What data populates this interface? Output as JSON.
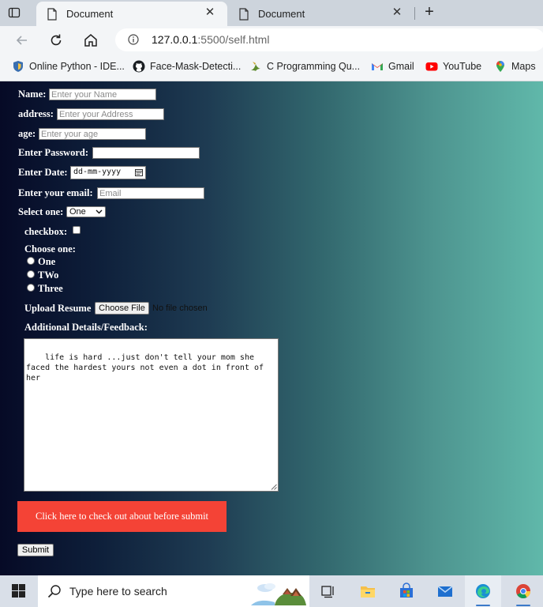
{
  "browser": {
    "tabs": [
      {
        "title": "Document",
        "active": true
      },
      {
        "title": "Document",
        "active": false
      }
    ],
    "url": {
      "host": "127.0.0.1",
      "rest": ":5500/self.html"
    },
    "bookmarks": [
      {
        "label": "Online Python - IDE...",
        "icon": "python-shield-icon"
      },
      {
        "label": "Face-Mask-Detecti...",
        "icon": "github-icon"
      },
      {
        "label": "C Programming Qu...",
        "icon": "bird-icon"
      },
      {
        "label": "Gmail",
        "icon": "gmail-icon"
      },
      {
        "label": "YouTube",
        "icon": "youtube-icon"
      },
      {
        "label": "Maps",
        "icon": "maps-pin-icon"
      }
    ]
  },
  "form": {
    "name_label": "Name:",
    "name_placeholder": "Enter your Name",
    "address_label": "address:",
    "address_placeholder": "Enter your Address",
    "age_label": "age:",
    "age_placeholder": "Enter your age",
    "password_label": "Enter Password:",
    "date_label": "Enter Date:",
    "date_value": "dd-mm-yyyy",
    "email_label": "Enter your email:",
    "email_placeholder": "Email",
    "select_label": "Select one:",
    "select_value": "One",
    "checkbox_label": "checkbox:",
    "choose_label": "Choose one:",
    "radios": [
      "One",
      "TWo",
      "Three"
    ],
    "upload_label": "Upload Resume",
    "file_button": "Choose File",
    "file_status": "No file chosen",
    "feedback_label": "Additional Details/Feedback:",
    "feedback_text": "life is hard ...just don't tell your mom she faced the hardest yours not even a dot in front of her",
    "about_button": "Click here to check out about before submit",
    "submit_button": "Submit"
  },
  "colors": {
    "accent_red": "#f44336",
    "gradient_start": "#060a26",
    "gradient_end": "#60b8aa"
  },
  "taskbar": {
    "search_placeholder": "Type here to search",
    "icons": [
      "task-view-icon",
      "file-explorer-icon",
      "microsoft-store-icon",
      "mail-icon",
      "edge-icon",
      "chrome-icon"
    ]
  }
}
